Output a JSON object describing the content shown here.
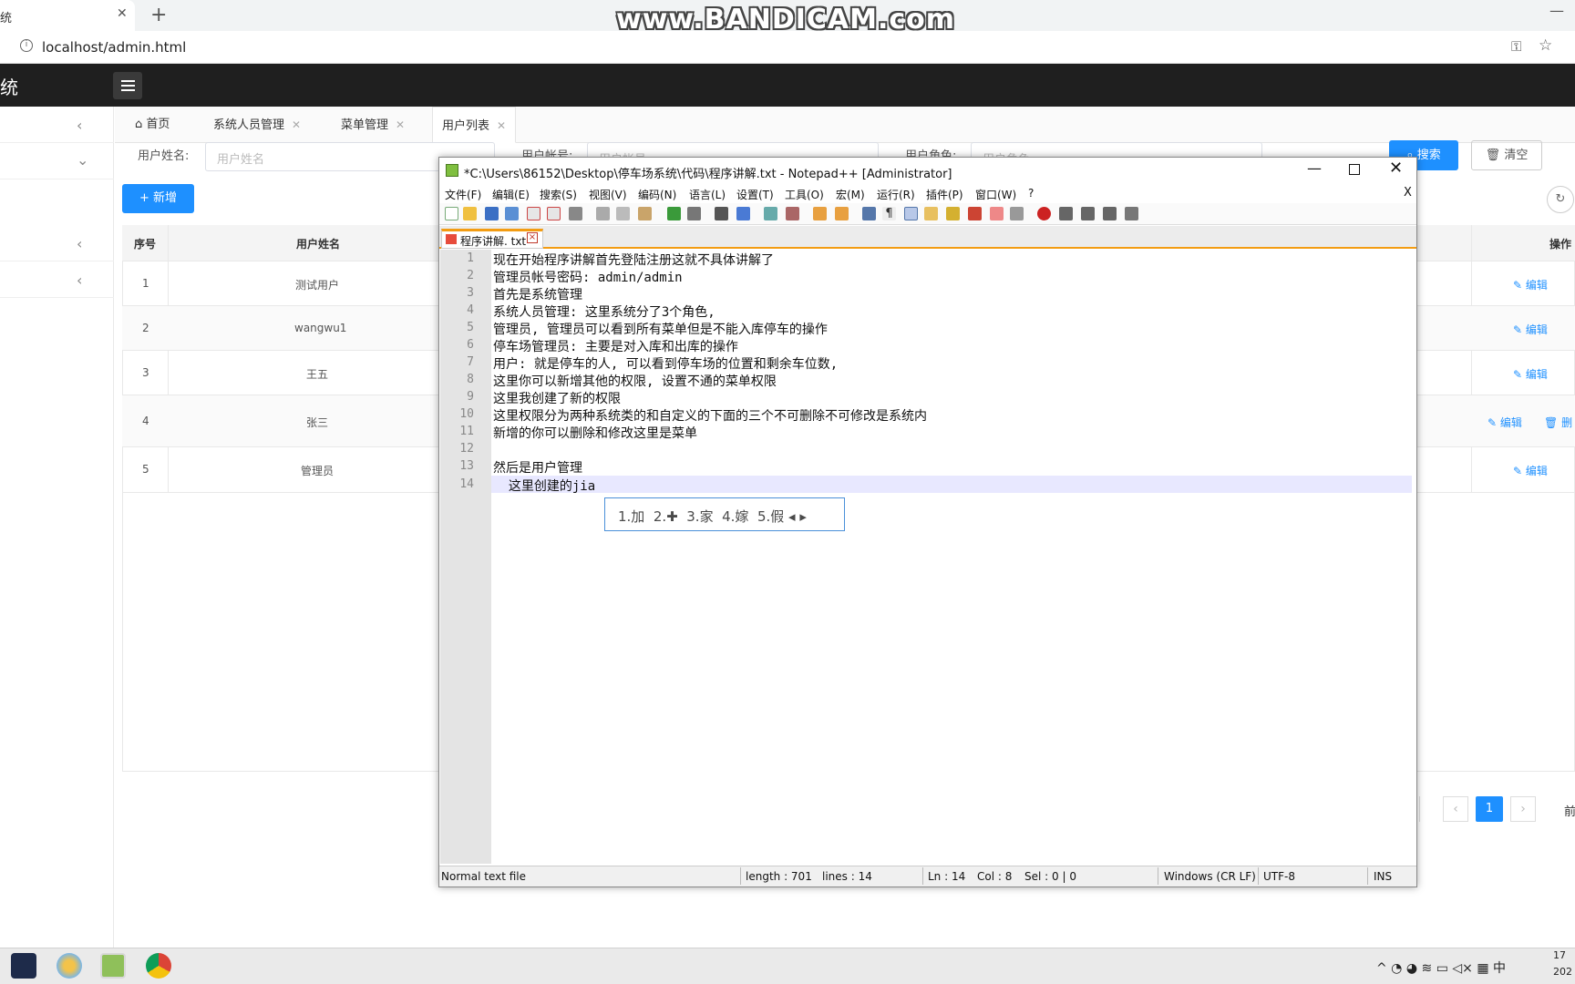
{
  "browser": {
    "tab_title": "统",
    "url": "localhost/admin.html",
    "watermark": "www.BANDICAM.com"
  },
  "app": {
    "title_fragment": "统"
  },
  "admin_tabs": [
    {
      "label": "首页"
    },
    {
      "label": "系统人员管理"
    },
    {
      "label": "菜单管理"
    },
    {
      "label": "用户列表"
    }
  ],
  "search": {
    "name_label": "用户姓名:",
    "name_placeholder": "用户姓名",
    "account_label": "用户帐号:",
    "account_placeholder": "用户帐号",
    "role_label": "用户角色:",
    "role_placeholder": "用户角色",
    "search_button": "搜索",
    "clear_button": "清空",
    "add_button": "新增"
  },
  "table": {
    "headers": {
      "index": "序号",
      "name": "用户姓名",
      "ops": "操作"
    },
    "rows": [
      {
        "index": "1",
        "name": "测试用户",
        "ops": "编辑"
      },
      {
        "index": "2",
        "name": "wangwu1",
        "ops": "编辑"
      },
      {
        "index": "3",
        "name": "王五",
        "ops": "编辑"
      },
      {
        "index": "4",
        "name": "张三",
        "ops": "编辑",
        "ops2": "删"
      },
      {
        "index": "5",
        "name": "管理员",
        "ops": "编辑"
      }
    ]
  },
  "pagination": {
    "current": "1",
    "front": "前"
  },
  "notepad": {
    "title": "*C:\\Users\\86152\\Desktop\\停车场系统\\代码\\程序讲解.txt - Notepad++ [Administrator]",
    "menu": [
      "文件(F)",
      "编辑(E)",
      "搜索(S)",
      "视图(V)",
      "编码(N)",
      "语言(L)",
      "设置(T)",
      "工具(O)",
      "宏(M)",
      "运行(R)",
      "插件(P)",
      "窗口(W)",
      "?"
    ],
    "menu_close": "X",
    "tab_name": "程序讲解. txt",
    "lines": [
      {
        "n": "1",
        "text": "现在开始程序讲解首先登陆注册这就不具体讲解了"
      },
      {
        "n": "2",
        "text": "管理员帐号密码: admin/admin"
      },
      {
        "n": "3",
        "text": "首先是系统管理"
      },
      {
        "n": "4",
        "text": "系统人员管理: 这里系统分了3个角色,"
      },
      {
        "n": "5",
        "text": "管理员, 管理员可以看到所有菜单但是不能入库停车的操作"
      },
      {
        "n": "6",
        "text": "停车场管理员: 主要是对入库和出库的操作"
      },
      {
        "n": "7",
        "text": "用户: 就是停车的人, 可以看到停车场的位置和剩余车位数,"
      },
      {
        "n": "8",
        "text": "这里你可以新增其他的权限, 设置不通的菜单权限"
      },
      {
        "n": "9",
        "text": "这里我创建了新的权限"
      },
      {
        "n": "10",
        "text": "这里权限分为两种系统类的和自定义的下面的三个不可删除不可修改是系统内"
      },
      {
        "n": "11",
        "text": "新增的你可以删除和修改这里是菜单"
      },
      {
        "n": "12",
        "text": ""
      },
      {
        "n": "13",
        "text": "然后是用户管理"
      },
      {
        "n": "14",
        "text": "  这里创建的jia"
      }
    ],
    "ime_candidates": "1.加  2.✚  3.家  4.嫁  5.假 ◂ ▸",
    "status": {
      "type": "Normal text file",
      "length": "length : 701",
      "lines": "lines : 14",
      "ln": "Ln : 14",
      "col": "Col : 8",
      "sel": "Sel : 0 | 0",
      "eol": "Windows (CR LF)",
      "encoding": "UTF-8",
      "mode": "INS"
    }
  },
  "taskbar": {
    "tray": "^ ◔ ◕ ≋ ▭ ◁× ▦ 中",
    "clock1": "17",
    "clock2": "202"
  }
}
